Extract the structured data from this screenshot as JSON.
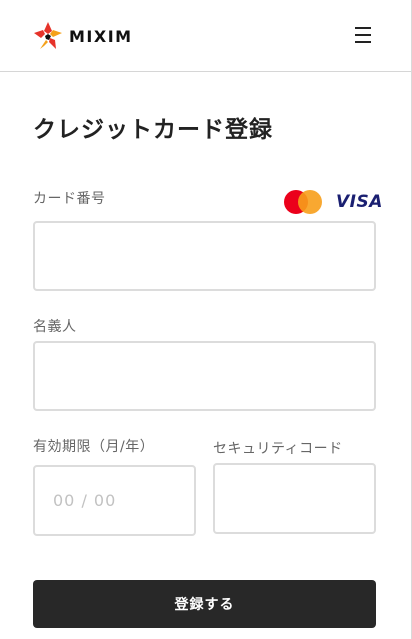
{
  "header": {
    "logo_text": "MIXIM",
    "logo_icon": "mixim-star-logo",
    "menu_icon": "hamburger-menu-icon"
  },
  "page": {
    "title": "クレジットカード登録"
  },
  "form": {
    "card_number": {
      "label": "カード番号",
      "value": "",
      "placeholder": ""
    },
    "card_brands": {
      "mastercard_colors": [
        "#eb001b",
        "#f79e1b"
      ],
      "visa_label": "VISA",
      "visa_color": "#1a1f71"
    },
    "holder_name": {
      "label": "名義人",
      "value": "",
      "placeholder": ""
    },
    "expiry": {
      "label": "有効期限（月/年）",
      "value": "",
      "placeholder": "00 / 00"
    },
    "security_code": {
      "label": "セキュリティコード",
      "value": "",
      "placeholder": ""
    },
    "submit_label": "登録する"
  },
  "colors": {
    "button_bg": "#282828",
    "input_border": "#dcdcdc"
  }
}
